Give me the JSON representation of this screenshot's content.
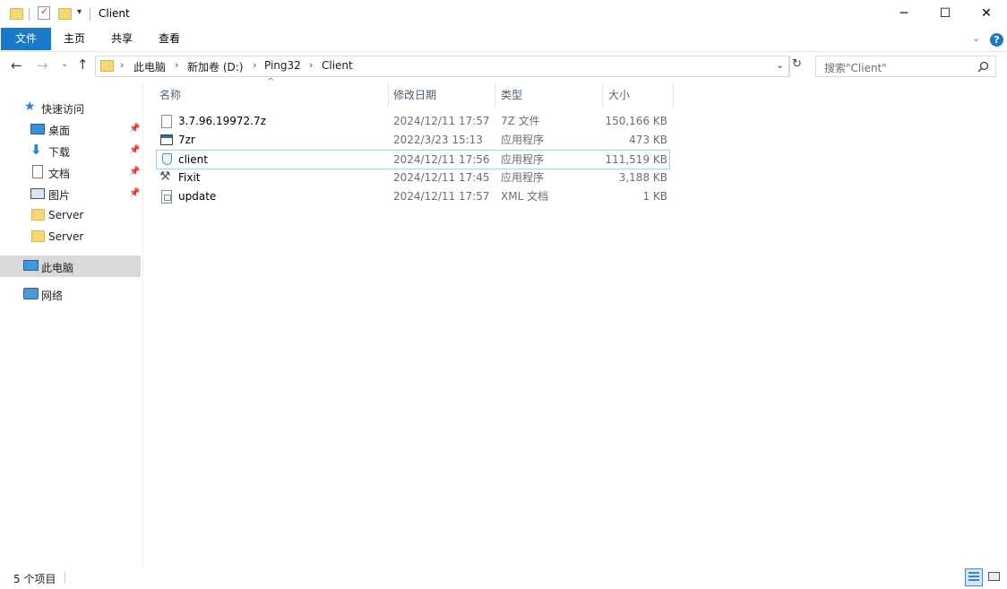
{
  "window": {
    "title": "Client",
    "controls": {
      "minimize": "─",
      "maximize": "☐",
      "close": "✕"
    }
  },
  "ribbon": {
    "tabs": [
      {
        "label": "文件"
      },
      {
        "label": "主页"
      },
      {
        "label": "共享"
      },
      {
        "label": "查看"
      }
    ],
    "accent": "#1979ca"
  },
  "address": {
    "breadcrumbs": [
      "此电脑",
      "新加卷 (D:)",
      "Ping32",
      "Client"
    ],
    "search_placeholder": "搜索\"Client\""
  },
  "sidebar": {
    "quick_access_label": "快速访问",
    "items": [
      {
        "label": "桌面",
        "icon": "desktop-icon",
        "pinned": true
      },
      {
        "label": "下载",
        "icon": "download-icon",
        "pinned": true
      },
      {
        "label": "文档",
        "icon": "document-icon",
        "pinned": true
      },
      {
        "label": "图片",
        "icon": "pictures-icon",
        "pinned": true
      },
      {
        "label": "Server",
        "icon": "folder-icon",
        "pinned": false
      },
      {
        "label": "Server",
        "icon": "folder-icon",
        "pinned": false
      }
    ],
    "this_pc_label": "此电脑",
    "network_label": "网络"
  },
  "columns": {
    "name": "名称",
    "date": "修改日期",
    "type": "类型",
    "size": "大小"
  },
  "files": [
    {
      "name": "3.7.96.19972.7z",
      "date": "2024/12/11 17:57",
      "type": "7Z 文件",
      "size": "150,166 KB",
      "icon": "archive-file-icon"
    },
    {
      "name": "7zr",
      "date": "2022/3/23 15:13",
      "type": "应用程序",
      "size": "473 KB",
      "icon": "app-window-icon"
    },
    {
      "name": "client",
      "date": "2024/12/11 17:56",
      "type": "应用程序",
      "size": "111,519 KB",
      "icon": "shield-app-icon",
      "selected": true
    },
    {
      "name": "Fixit",
      "date": "2024/12/11 17:45",
      "type": "应用程序",
      "size": "3,188 KB",
      "icon": "tools-icon"
    },
    {
      "name": "update",
      "date": "2024/12/11 17:57",
      "type": "XML 文档",
      "size": "1 KB",
      "icon": "xml-file-icon"
    }
  ],
  "status": {
    "item_count": "5 个项目"
  }
}
